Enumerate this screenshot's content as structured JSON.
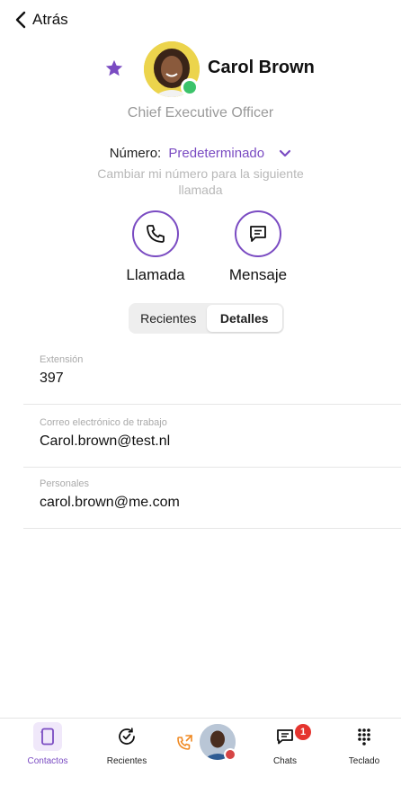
{
  "nav": {
    "back_label": "Atrás"
  },
  "contact": {
    "name": "Carol Brown",
    "title": "Chief Executive Officer",
    "favorite": true,
    "presence": "available"
  },
  "number": {
    "label": "Número:",
    "value": "Predeterminado",
    "hint": "Cambiar mi número para la siguiente llamada"
  },
  "actions": [
    {
      "label": "Llamada",
      "icon": "phone-icon"
    },
    {
      "label": "Mensaje",
      "icon": "message-icon"
    }
  ],
  "segments": [
    {
      "label": "Recientes",
      "active": false
    },
    {
      "label": "Detalles",
      "active": true
    }
  ],
  "details": [
    {
      "label": "Extensión",
      "value": "397"
    },
    {
      "label": "Correo electrónico de trabajo",
      "value": "Carol.brown@test.nl"
    },
    {
      "label": "Personales",
      "value": "carol.brown@me.com"
    }
  ],
  "tabbar": {
    "items": [
      {
        "label": "Contactos",
        "icon": "contacts-icon",
        "active": true
      },
      {
        "label": "Recientes",
        "icon": "recents-icon",
        "active": false
      },
      {
        "label": "Chats",
        "icon": "chat-icon",
        "active": false,
        "badge": "1"
      },
      {
        "label": "Teclado",
        "icon": "keypad-icon",
        "active": false
      }
    ]
  },
  "colors": {
    "accent": "#7a4bc2",
    "online": "#3cc36a",
    "busy": "#d64545",
    "badge": "#e5342e",
    "call_arrow": "#f08a24"
  }
}
